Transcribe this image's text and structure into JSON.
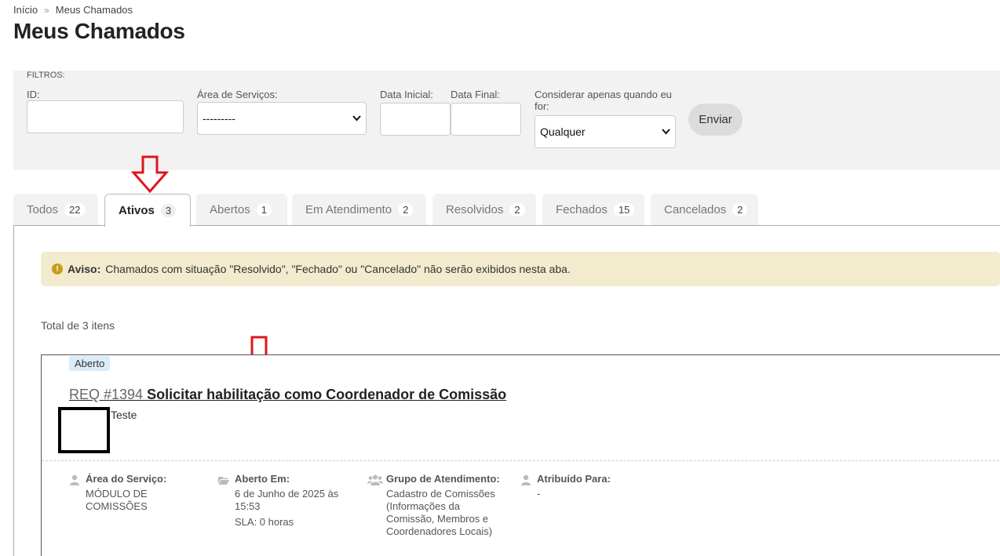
{
  "breadcrumb": {
    "home": "Início",
    "separator": "»",
    "current": "Meus Chamados"
  },
  "page_title": "Meus Chamados",
  "filters": {
    "title": "FILTROS:",
    "id_label": "ID:",
    "id_value": "",
    "area_label": "Área de Serviços:",
    "area_value": "---------",
    "start_label": "Data Inicial:",
    "start_value": "",
    "end_label": "Data Final:",
    "end_value": "",
    "consider_label": "Considerar apenas quando eu for:",
    "consider_value": "Qualquer",
    "submit_label": "Enviar"
  },
  "tabs": [
    {
      "label": "Todos",
      "count": "22",
      "active": false
    },
    {
      "label": "Ativos",
      "count": "3",
      "active": true
    },
    {
      "label": "Abertos",
      "count": "1",
      "active": false
    },
    {
      "label": "Em Atendimento",
      "count": "2",
      "active": false
    },
    {
      "label": "Resolvidos",
      "count": "2",
      "active": false
    },
    {
      "label": "Fechados",
      "count": "15",
      "active": false
    },
    {
      "label": "Cancelados",
      "count": "2",
      "active": false
    }
  ],
  "notice": {
    "icon": "exclamation-circle-icon",
    "strong": "Aviso:",
    "text": "Chamados com situação \"Resolvido\", \"Fechado\" ou \"Cancelado\" não serão exibidos nesta aba."
  },
  "total_text": "Total de 3 itens",
  "ticket": {
    "status": "Aberto",
    "req": "REQ #1394",
    "title": "Solicitar habilitação como Coordenador de Comissão",
    "author": "Teste",
    "meta": {
      "area_title": "Área do Serviço:",
      "area_value": "MÓDULO DE COMISSÕES",
      "opened_title": "Aberto Em:",
      "opened_value": "6 de Junho de 2025 às 15:53",
      "sla": "SLA: 0 horas",
      "group_title": "Grupo de Atendimento:",
      "group_value": "Cadastro de Comissões (Informações da Comissão, Membros e Coordenadores Locais)",
      "assigned_title": "Atribuído Para:",
      "assigned_value": "-"
    }
  },
  "colors": {
    "annotation_arrow": "#e0141e",
    "notice_bg": "#f2ebce",
    "badge_bg": "#d9ecf7"
  }
}
